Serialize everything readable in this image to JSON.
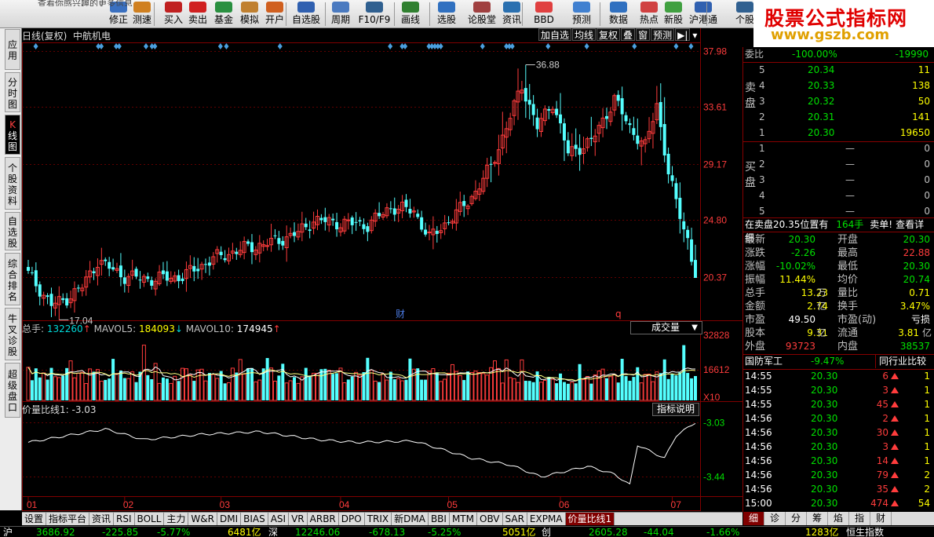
{
  "toolbar": {
    "notice": "查看你感兴趣的更多信息",
    "buttons": [
      {
        "label": "修正",
        "icon": "edit-icon"
      },
      {
        "label": "测速",
        "icon": "speed-icon"
      },
      {
        "label": "买入",
        "icon": "buy-icon"
      },
      {
        "label": "卖出",
        "icon": "sell-icon"
      },
      {
        "label": "基金",
        "icon": "fund-icon"
      },
      {
        "label": "模拟",
        "icon": "simulate-icon"
      },
      {
        "label": "开户",
        "icon": "open-account-icon"
      },
      {
        "label": "自选股",
        "icon": "watchlist-icon"
      },
      {
        "label": "周期",
        "icon": "period-icon"
      },
      {
        "label": "F10/F9",
        "icon": "f10-icon"
      },
      {
        "label": "画线",
        "icon": "draw-line-icon"
      },
      {
        "label": "选股",
        "icon": "stock-pick-icon"
      },
      {
        "label": "论股堂",
        "icon": "forum-icon"
      },
      {
        "label": "资讯",
        "icon": "news-icon"
      },
      {
        "label": "BBD",
        "icon": "bbd-icon"
      },
      {
        "label": "预测",
        "icon": "forecast-icon"
      },
      {
        "label": "数据",
        "icon": "data-icon"
      },
      {
        "label": "热点",
        "icon": "hot-icon"
      },
      {
        "label": "新股",
        "icon": "new-stock-icon"
      },
      {
        "label": "沪港通",
        "icon": "hk-connect-icon"
      },
      {
        "label": "个股",
        "icon": "stock-icon"
      }
    ]
  },
  "promo": {
    "title": "股票公式指标网",
    "url": "www.gszb.com"
  },
  "left_tabs": [
    "应用",
    "分时图",
    "K线图",
    "个股资料",
    "自选股",
    "综合排名",
    "牛叉诊股",
    "超级盘口"
  ],
  "chart_header": {
    "mode": "日线(复权)",
    "stock": "中航机电"
  },
  "chart_buttons": [
    "加自选",
    "均线",
    "复权",
    "叠",
    "窗",
    "预测"
  ],
  "price_axis": [
    "37.98",
    "33.61",
    "29.17",
    "24.80",
    "20.37"
  ],
  "markers": {
    "high": "36.88",
    "low": "17.04",
    "cai": "财",
    "q": "q"
  },
  "volume": {
    "total_label": "总手:",
    "total": "132260",
    "mavol5_label": "MAVOL5:",
    "mavol5": "184093",
    "mavol10_label": "MAVOL10:",
    "mavol10": "174945",
    "selector": "成交量",
    "axis": [
      "32828",
      "16612",
      "X10"
    ]
  },
  "indicator": {
    "label": "价量比线1:",
    "value": "-3.03",
    "button": "指标说明",
    "axis": [
      "-3.03",
      "-3.44"
    ]
  },
  "x_axis": [
    "01",
    "02",
    "03",
    "04",
    "05",
    "06",
    "07"
  ],
  "bottom_tabs": [
    "设置",
    "指标平台",
    "资讯",
    "RSI",
    "BOLL",
    "主力",
    "W&R",
    "DMI",
    "BIAS",
    "ASI",
    "VR",
    "ARBR",
    "DPO",
    "TRIX",
    "新DMA",
    "BBI",
    "MTM",
    "OBV",
    "SAR",
    "EXPMA",
    "价量比线1"
  ],
  "right_panel": {
    "weibi_label": "委比",
    "weibi": "-100.00%",
    "weicha": "-19990",
    "sell_label": "卖盘",
    "buy_label": "买盘",
    "asks": [
      {
        "lvl": "5",
        "price": "20.34",
        "vol": "11"
      },
      {
        "lvl": "4",
        "price": "20.33",
        "vol": "138"
      },
      {
        "lvl": "3",
        "price": "20.32",
        "vol": "50"
      },
      {
        "lvl": "2",
        "price": "20.31",
        "vol": "141"
      },
      {
        "lvl": "1",
        "price": "20.30",
        "vol": "19650"
      }
    ],
    "bids": [
      {
        "lvl": "1",
        "price": "—",
        "vol": "0"
      },
      {
        "lvl": "2",
        "price": "—",
        "vol": "0"
      },
      {
        "lvl": "3",
        "price": "—",
        "vol": "0"
      },
      {
        "lvl": "4",
        "price": "—",
        "vol": "0"
      },
      {
        "lvl": "5",
        "price": "—",
        "vol": "0"
      }
    ],
    "notice": "在卖盘20.35位置有",
    "notice_vol": "164手",
    "notice_type": "卖单!",
    "notice_link": "查看详细",
    "quotes": [
      {
        "l": "最新",
        "v": "20.30",
        "vc": "grn",
        "l2": "开盘",
        "v2": "20.30",
        "v2c": "grn"
      },
      {
        "l": "涨跌",
        "v": "-2.26",
        "vc": "grn",
        "l2": "最高",
        "v2": "22.88",
        "v2c": "red"
      },
      {
        "l": "涨幅",
        "v": "-10.02%",
        "vc": "grn",
        "l2": "最低",
        "v2": "20.30",
        "v2c": "grn"
      },
      {
        "l": "振幅",
        "v": "11.44%",
        "vc": "yel",
        "l2": "均价",
        "v2": "20.74",
        "v2c": "grn"
      },
      {
        "l": "总手",
        "v": "13.23",
        "vc": "yel",
        "u": "万",
        "l2": "量比",
        "v2": "0.71",
        "v2c": "yel"
      },
      {
        "l": "金额",
        "v": "2.74",
        "vc": "yel",
        "u": "亿",
        "l2": "换手",
        "v2": "3.47%",
        "v2c": "yel"
      },
      {
        "l": "市盈",
        "v": "49.50",
        "vc": "wht",
        "l2": "市盈(动)",
        "v2": "亏损",
        "v2c": "wht"
      },
      {
        "l": "股本",
        "v": "9.31",
        "vc": "yel",
        "u": "亿",
        "l2": "流通",
        "v2": "3.81",
        "v2c": "yel",
        "u2": "亿"
      },
      {
        "l": "外盘",
        "v": "93723",
        "vc": "red",
        "l2": "内盘",
        "v2": "38537",
        "v2c": "grn"
      }
    ],
    "industry": "国防军工",
    "industry_chg": "-9.47%",
    "industry_btn": "同行业比较",
    "ticks": [
      {
        "t": "14:55",
        "p": "20.30",
        "v": "6",
        "n": "1"
      },
      {
        "t": "14:55",
        "p": "20.30",
        "v": "3",
        "n": "1"
      },
      {
        "t": "14:55",
        "p": "20.30",
        "v": "45",
        "n": "1"
      },
      {
        "t": "14:56",
        "p": "20.30",
        "v": "2",
        "n": "1"
      },
      {
        "t": "14:56",
        "p": "20.30",
        "v": "30",
        "n": "1"
      },
      {
        "t": "14:56",
        "p": "20.30",
        "v": "3",
        "n": "1"
      },
      {
        "t": "14:56",
        "p": "20.30",
        "v": "14",
        "n": "1"
      },
      {
        "t": "14:56",
        "p": "20.30",
        "v": "79",
        "n": "2"
      },
      {
        "t": "14:56",
        "p": "20.30",
        "v": "35",
        "n": "2"
      },
      {
        "t": "15:00",
        "p": "20.30",
        "v": "474",
        "n": "54"
      }
    ],
    "tabs": [
      "细",
      "诊",
      "分",
      "筹",
      "焰",
      "指",
      "财"
    ]
  },
  "status_bar": [
    {
      "t": "沪",
      "c": "wht"
    },
    {
      "t": "3686.92",
      "c": "grn"
    },
    {
      "t": "-225.85",
      "c": "grn"
    },
    {
      "t": "-5.77%",
      "c": "grn"
    },
    {
      "t": "6481亿",
      "c": "yel"
    },
    {
      "t": "深",
      "c": "wht"
    },
    {
      "t": "12246.06",
      "c": "grn"
    },
    {
      "t": "-678.13",
      "c": "grn"
    },
    {
      "t": "-5.25%",
      "c": "grn"
    },
    {
      "t": "5051亿",
      "c": "yel"
    },
    {
      "t": "创",
      "c": "wht"
    },
    {
      "t": "2605.28",
      "c": "grn"
    },
    {
      "t": "-44.04",
      "c": "grn"
    },
    {
      "t": "-1.66%",
      "c": "grn"
    },
    {
      "t": "1283亿",
      "c": "yel"
    },
    {
      "t": "恒生指数",
      "c": "wht"
    }
  ],
  "chart_data": {
    "type": "candlestick",
    "title": "中航机电 日线(复权)",
    "ylim": [
      17.0,
      38.5
    ],
    "x_months": [
      "01",
      "02",
      "03",
      "04",
      "05",
      "06",
      "07"
    ],
    "price_keypoints": [
      [
        0,
        20.6
      ],
      [
        6,
        18.2
      ],
      [
        9,
        18.5
      ],
      [
        14,
        19.6
      ],
      [
        18,
        21.6
      ],
      [
        25,
        20.4
      ],
      [
        32,
        20.2
      ],
      [
        40,
        20.4
      ],
      [
        48,
        21.8
      ],
      [
        56,
        22.6
      ],
      [
        64,
        23.1
      ],
      [
        70,
        23.8
      ],
      [
        74,
        24.8
      ],
      [
        80,
        24.6
      ],
      [
        88,
        24.4
      ],
      [
        94,
        25.8
      ],
      [
        100,
        25.5
      ],
      [
        104,
        23.4
      ],
      [
        107,
        24.2
      ],
      [
        112,
        25.6
      ],
      [
        116,
        27.0
      ],
      [
        120,
        29.0
      ],
      [
        124,
        32.0
      ],
      [
        128,
        35.3
      ],
      [
        132,
        32.0
      ],
      [
        136,
        34.0
      ],
      [
        140,
        30.0
      ],
      [
        146,
        30.9
      ],
      [
        152,
        34.2
      ],
      [
        156,
        32.0
      ],
      [
        160,
        30.5
      ],
      [
        163,
        33.8
      ],
      [
        166,
        28.5
      ],
      [
        168,
        26.1
      ],
      [
        171,
        23.3
      ],
      [
        173,
        20.3
      ]
    ],
    "high": 36.88,
    "low": 17.04,
    "last": 20.3,
    "volume_ylim": [
      0,
      32828
    ],
    "indicator_keypoints": [
      [
        0,
        -3.18
      ],
      [
        20,
        -3.08
      ],
      [
        30,
        -3.16
      ],
      [
        45,
        -3.12
      ],
      [
        60,
        -3.1
      ],
      [
        75,
        -3.16
      ],
      [
        85,
        -3.18
      ],
      [
        100,
        -3.17
      ],
      [
        115,
        -3.3
      ],
      [
        125,
        -3.35
      ],
      [
        133,
        -3.44
      ],
      [
        145,
        -3.36
      ],
      [
        152,
        -3.42
      ],
      [
        156,
        -3.5
      ],
      [
        158,
        -3.2
      ],
      [
        165,
        -3.3
      ],
      [
        168,
        -3.13
      ],
      [
        173,
        -3.03
      ]
    ]
  }
}
